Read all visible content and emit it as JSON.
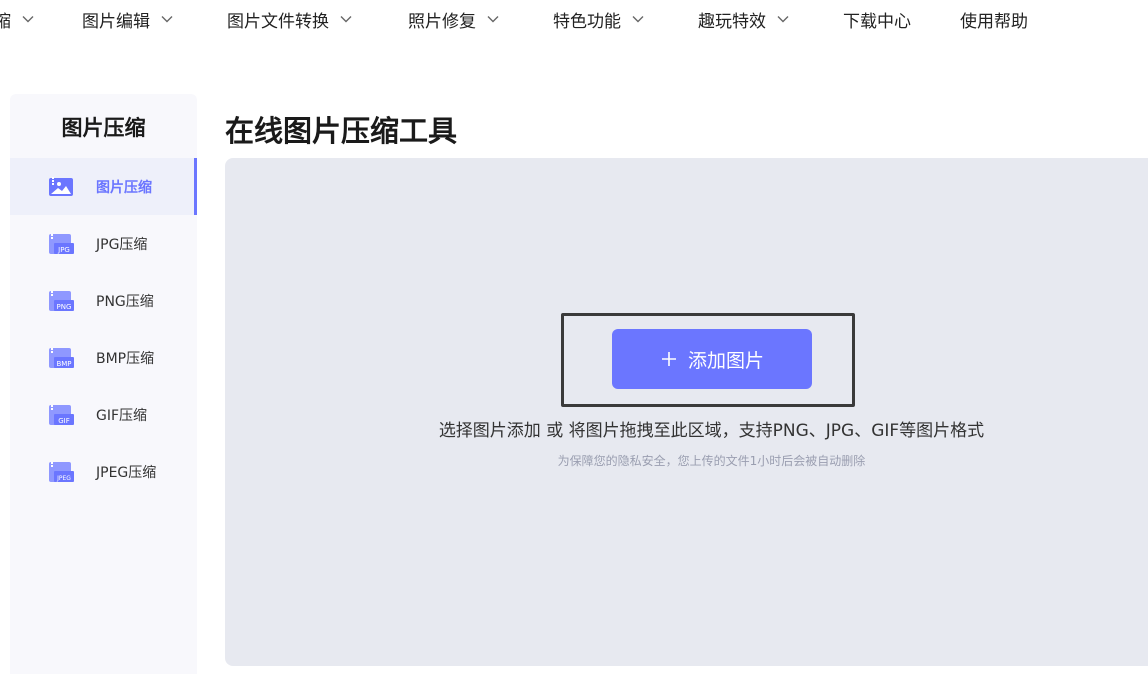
{
  "nav": {
    "items": [
      {
        "label": "缩"
      },
      {
        "label": "图片编辑"
      },
      {
        "label": "图片文件转换"
      },
      {
        "label": "照片修复"
      },
      {
        "label": "特色功能"
      },
      {
        "label": "趣玩特效"
      },
      {
        "label": "下载中心"
      },
      {
        "label": "使用帮助"
      }
    ]
  },
  "sidebar": {
    "title": "图片压缩",
    "items": [
      {
        "label": "图片压缩",
        "icon": "image-compress-icon",
        "active": true
      },
      {
        "label": "JPG压缩",
        "icon": "jpg-file-icon",
        "badge": "JPG"
      },
      {
        "label": "PNG压缩",
        "icon": "png-file-icon",
        "badge": "PNG"
      },
      {
        "label": "BMP压缩",
        "icon": "bmp-file-icon",
        "badge": "BMP"
      },
      {
        "label": "GIF压缩",
        "icon": "gif-file-icon",
        "badge": "GIF"
      },
      {
        "label": "JPEG压缩",
        "icon": "jpeg-file-icon",
        "badge": "JPEG"
      }
    ]
  },
  "main": {
    "title": "在线图片压缩工具",
    "add_button": "添加图片",
    "hint": "选择图片添加 或 将图片拖拽至此区域，支持PNG、JPG、GIF等图片格式",
    "privacy": "为保障您的隐私安全，您上传的文件1小时后会被自动删除"
  },
  "colors": {
    "accent": "#6b76ff",
    "dropzone": "#e7e9f0",
    "sidebar_bg": "#f8f8fc"
  }
}
